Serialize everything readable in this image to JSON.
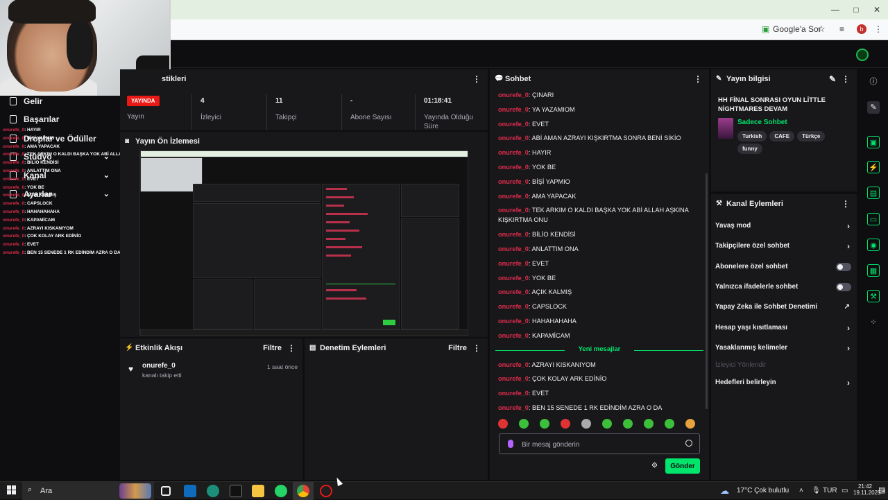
{
  "browser": {
    "google_ask_label": "Google'a Sor",
    "profile_initial": "b",
    "window_controls": [
      "—",
      "□",
      "✕"
    ]
  },
  "sidebar": {
    "items": [
      {
        "label": "Gelir",
        "icon": "bar-chart-icon"
      },
      {
        "label": "Başarılar",
        "icon": "trophy-icon"
      },
      {
        "label": "Droplar ve Ödüller",
        "icon": "gift-icon",
        "expandable": true
      },
      {
        "label": "Stüdyo",
        "icon": "video-icon",
        "expandable": true
      },
      {
        "label": "Kanal",
        "icon": "channel-icon",
        "expandable": true
      },
      {
        "label": "Ayarlar",
        "icon": "gear-icon",
        "expandable": true
      }
    ],
    "overlay_chat": [
      {
        "user": "onurefe_0",
        "text": ": HAYIR"
      },
      {
        "user": "onurefe_0",
        "text": ": BİŞİ YAPMIO"
      },
      {
        "user": "onurefe_0",
        "text": ": AMA YAPACAK"
      },
      {
        "user": "onurefe_0",
        "text": ": TEK ARKIM O KALDI BAŞKA YOK ABİ ALLAH AŞKINA KIŞKIRTMA ONU"
      },
      {
        "user": "onurefe_0",
        "text": ": BİLİO KENDİSİ"
      },
      {
        "user": "onurefe_0",
        "text": ": ANLATTIM ONA"
      },
      {
        "user": "onurefe_0",
        "text": ": EVET"
      },
      {
        "user": "onurefe_0",
        "text": ": YOK BE"
      },
      {
        "user": "onurefe_0",
        "text": ": AÇIK KALMIŞ"
      },
      {
        "user": "onurefe_0",
        "text": ": CAPSLOCK"
      },
      {
        "user": "onurefe_0",
        "text": ": HAHAHAHAHA"
      },
      {
        "user": "onurefe_0",
        "text": ": KAPAMİCAM"
      },
      {
        "user": "onurefe_0",
        "text": ": AZRAYI KISKANIYOM"
      },
      {
        "user": "onurefe_0",
        "text": ": ÇOK KOLAY ARK EDİNİO"
      },
      {
        "user": "onurefe_0",
        "text": ": EVET"
      },
      {
        "user": "onurefe_0",
        "text": ": BEN 15 SENEDE 1 RK EDİNDİM AZRA O DA"
      }
    ]
  },
  "stats": {
    "title_partial": "stikleri",
    "live_badge": "YAYINDA",
    "items": [
      {
        "value": "",
        "label": "Yayın"
      },
      {
        "value": "4",
        "label": "İzleyici"
      },
      {
        "value": "11",
        "label": "Takipçi"
      },
      {
        "value": "-",
        "label": "Abone Sayısı"
      },
      {
        "value": "01:18:41",
        "label": "Yayında Olduğu Süre"
      }
    ]
  },
  "preview": {
    "title": "Yayın Ön İzlemesi"
  },
  "activity": {
    "title": "Etkinlik Akışı",
    "filter_label": "Filtre",
    "items": [
      {
        "user": "onurefe_0",
        "desc": "kanalı takip etti",
        "time": "1 saat önce"
      }
    ]
  },
  "moderation": {
    "title": "Denetim Eylemleri",
    "filter_label": "Filtre"
  },
  "chat": {
    "title": "Sohbet",
    "messages_before": [
      {
        "user": "onurefe_0",
        "text": ": ÇINARI"
      },
      {
        "user": "onurefe_0",
        "text": ": YA YAZAMIOM"
      },
      {
        "user": "onurefe_0",
        "text": ": EVET"
      },
      {
        "user": "onurefe_0",
        "text": ": ABİ AMAN AZRAYI KIŞKIRTMA SONRA BENİ SİKİO"
      },
      {
        "user": "onurefe_0",
        "text": ": HAYIR"
      },
      {
        "user": "onurefe_0",
        "text": ": YOK BE"
      },
      {
        "user": "onurefe_0",
        "text": ": BİŞİ YAPMIO"
      },
      {
        "user": "onurefe_0",
        "text": ": AMA YAPACAK"
      },
      {
        "user": "onurefe_0",
        "text": ": TEK ARKIM O KALDI BAŞKA YOK ABİ ALLAH AŞKINA KIŞKIRTMA ONU"
      },
      {
        "user": "onurefe_0",
        "text": ": BİLİO KENDİSİ"
      },
      {
        "user": "onurefe_0",
        "text": ": ANLATTIM ONA"
      },
      {
        "user": "onurefe_0",
        "text": ": EVET"
      },
      {
        "user": "onurefe_0",
        "text": ": YOK BE"
      },
      {
        "user": "onurefe_0",
        "text": ": AÇIK KALMIŞ"
      },
      {
        "user": "onurefe_0",
        "text": ": CAPSLOCK"
      },
      {
        "user": "onurefe_0",
        "text": ": HAHAHAHAHA"
      },
      {
        "user": "onurefe_0",
        "text": ": KAPAMİCAM"
      }
    ],
    "new_messages_label": "Yeni mesajlar",
    "messages_after": [
      {
        "user": "onurefe_0",
        "text": ": AZRAYI KISKANIYOM"
      },
      {
        "user": "onurefe_0",
        "text": ": ÇOK KOLAY ARK EDİNİO"
      },
      {
        "user": "onurefe_0",
        "text": ": EVET"
      },
      {
        "user": "onurefe_0",
        "text": ": BEN 15 SENEDE 1 RK EDİNDİM AZRA O DA"
      }
    ],
    "input_placeholder": "Bir mesaj gönderin",
    "send_label": "Gönder"
  },
  "stream_info": {
    "title": "Yayın bilgisi",
    "stream_title": "HH FİNAL SONRASI OYUN LİTTLE NİGHTMARES DEVAM",
    "category": "Sadece Sohbet",
    "tags": [
      "Turkish",
      "CAFE",
      "Türkçe",
      "funny"
    ]
  },
  "channel_actions": {
    "title": "Kanal Eylemleri",
    "items": [
      {
        "label": "Yavaş mod",
        "control": "chevron"
      },
      {
        "label": "Takipçilere özel sohbet",
        "control": "chevron"
      },
      {
        "label": "Abonelere özel sohbet",
        "control": "toggle"
      },
      {
        "label": "Yalnızca ifadelerle sohbet",
        "control": "toggle"
      },
      {
        "label": "Yapay Zeka ile Sohbet Denetimi",
        "control": "external"
      },
      {
        "label": "Hesap yaşı kısıtlaması",
        "control": "chevron"
      },
      {
        "label": "Yasaklanmış kelimeler",
        "control": "chevron"
      },
      {
        "label": "İzleyici Yönlendir",
        "control": "none",
        "disabled": true
      },
      {
        "label": "Hedefleri belirleyin",
        "control": "chevron"
      }
    ]
  },
  "taskbar": {
    "search_label": "Ara",
    "weather": "17°C  Çok bulutlu",
    "language": "TUR",
    "time": "21:42",
    "date": "19.11.2025",
    "notification_count": "4"
  },
  "colors": {
    "accent": "#00e56c",
    "username": "#e02c4b",
    "live": "#e91916",
    "panel": "#18181b",
    "background": "#0e0e10"
  }
}
